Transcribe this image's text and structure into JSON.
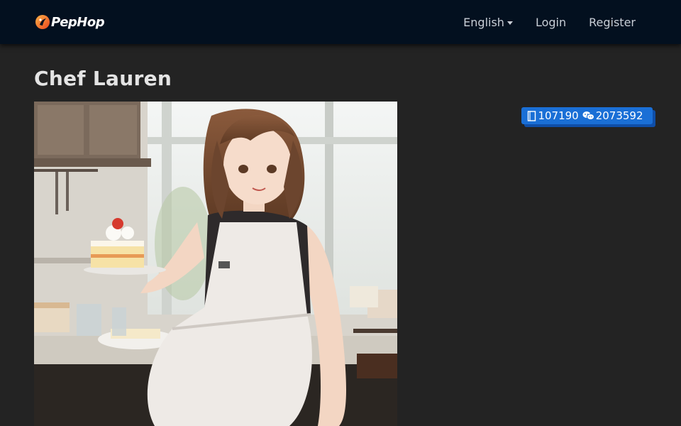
{
  "navbar": {
    "brand_name": "PepHop",
    "language_label": "English",
    "login_label": "Login",
    "register_label": "Register"
  },
  "page": {
    "title": "Chef Lauren"
  },
  "stats": {
    "bookmark_count": "107190",
    "chat_count": "2073592",
    "bookmark_icon": "bookmark-icon",
    "chat_icon": "chat-bubbles-icon",
    "badge_color": "#1a6fd6"
  },
  "colors": {
    "navbar_bg": "#03101f",
    "page_bg": "#232323",
    "brand_orange": "#f06a1f"
  }
}
